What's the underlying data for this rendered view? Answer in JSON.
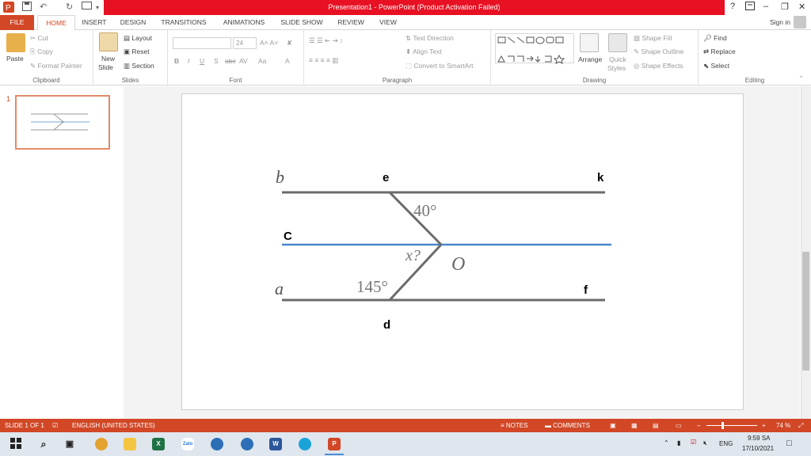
{
  "window": {
    "title": "Presentation1 - PowerPoint (Product Activation Failed)",
    "help": "?",
    "sign_in": "Sign in"
  },
  "tabs": [
    {
      "label": "FILE"
    },
    {
      "label": "HOME"
    },
    {
      "label": "INSERT"
    },
    {
      "label": "DESIGN"
    },
    {
      "label": "TRANSITIONS"
    },
    {
      "label": "ANIMATIONS"
    },
    {
      "label": "SLIDE SHOW"
    },
    {
      "label": "REVIEW"
    },
    {
      "label": "VIEW"
    }
  ],
  "ribbon": {
    "clipboard": {
      "paste": "Paste",
      "cut": "Cut",
      "copy": "Copy",
      "format_painter": "Format Painter",
      "label": "Clipboard"
    },
    "slides": {
      "new_slide_1": "New",
      "new_slide_2": "Slide",
      "layout": "Layout",
      "reset": "Reset",
      "section": "Section",
      "label": "Slides"
    },
    "font": {
      "size": "24",
      "label": "Font",
      "bold": "B",
      "italic": "I",
      "underline": "U",
      "shadow": "S",
      "strike": "abc",
      "spacing": "AV",
      "case": "Aa",
      "color": "A"
    },
    "paragraph": {
      "text_direction": "Text Direction",
      "align_text": "Align Text",
      "convert_smartart": "Convert to SmartArt",
      "label": "Paragraph"
    },
    "drawing": {
      "arrange": "Arrange",
      "quick_styles_1": "Quick",
      "quick_styles_2": "Styles",
      "shape_fill": "Shape Fill",
      "shape_outline": "Shape Outline",
      "shape_effects": "Shape Effects",
      "label": "Drawing"
    },
    "editing": {
      "find": "Find",
      "replace": "Replace",
      "select": "Select",
      "label": "Editing"
    }
  },
  "slide_pane": {
    "slide_number": "1"
  },
  "slide": {
    "labels": {
      "b": "b",
      "e": "e",
      "k": "k",
      "c": "C",
      "a": "a",
      "f": "f",
      "d": "d",
      "o": "O",
      "x": "x?",
      "angle_top": "40°",
      "angle_bottom": "145°"
    },
    "colors": {
      "parallel_line": "#6b6b6b",
      "mid_line": "#4a86c8"
    }
  },
  "status": {
    "slide_of": "SLIDE 1 OF 1",
    "language": "ENGLISH (UNITED STATES)",
    "notes": "NOTES",
    "comments": "COMMENTS",
    "zoom": "74 %"
  },
  "taskbar": {
    "language": "ENG",
    "time": "9:59 SA",
    "date": "17/10/2021",
    "zalo": "Zalo",
    "excel": "X",
    "word": "W",
    "ppt": "P"
  }
}
